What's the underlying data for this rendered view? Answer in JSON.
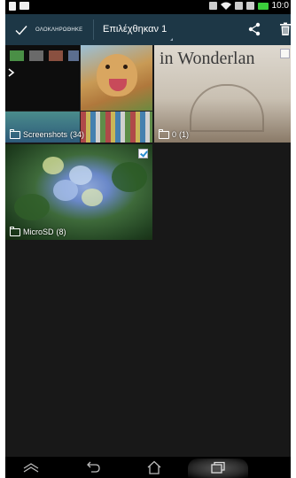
{
  "status_bar": {
    "time": "10:0"
  },
  "action_bar": {
    "done_label": "ΟΛΟΚΛΗΡΩΘΗΚΕ",
    "selected_label": "Επιλέχθηκαν 1"
  },
  "albums": [
    {
      "name": "Screenshots",
      "count": "(34)",
      "checked": false
    },
    {
      "name": "0",
      "count": "(1)",
      "checked": false,
      "overlay_text": "in Wonderlan"
    },
    {
      "name": "MicroSD",
      "count": "(8)",
      "checked": true
    }
  ],
  "colors": {
    "action_bar": "#1d3746",
    "screen_bg": "#181818",
    "check_accent": "#2a8fd0"
  }
}
